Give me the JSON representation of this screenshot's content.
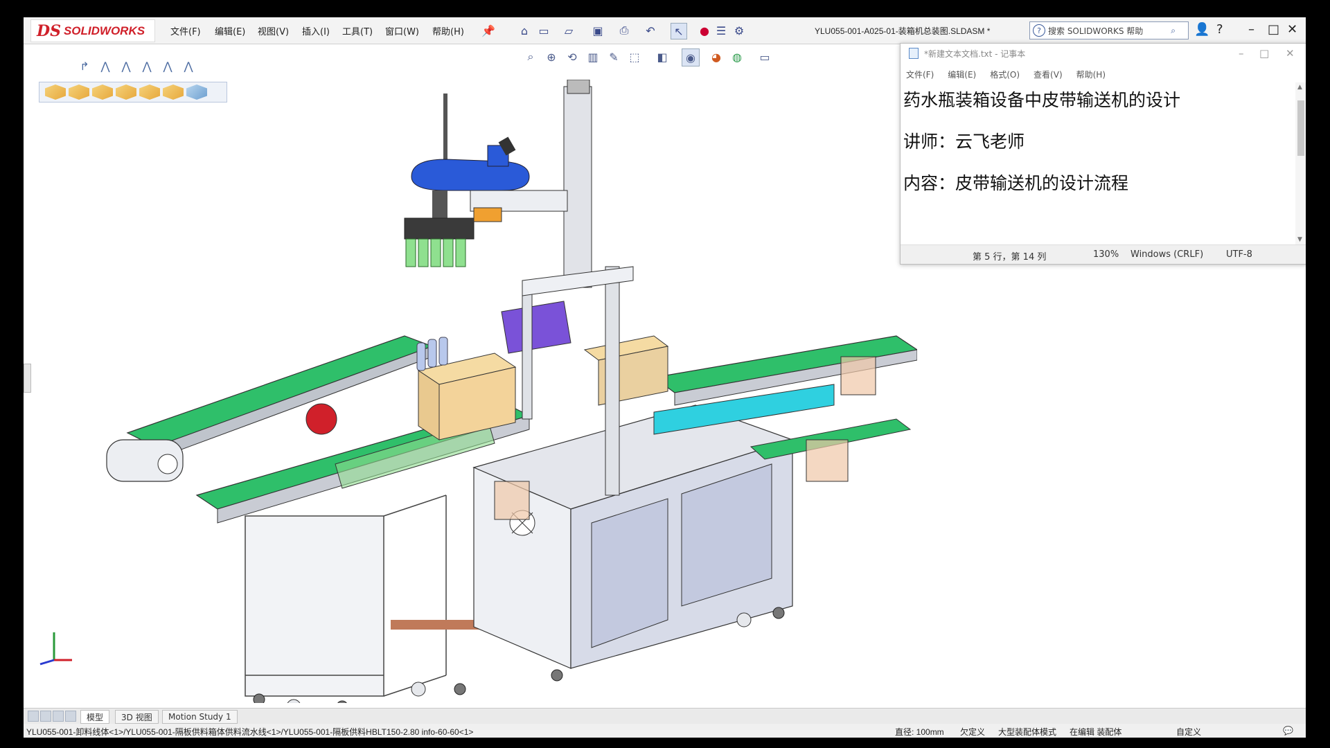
{
  "app": {
    "brand_ds": "DS",
    "brand_name": "SOLIDWORKS",
    "document_title": "YLU055-001-A025-01-装箱机总装图.SLDASM *",
    "search_placeholder": "搜索 SOLIDWORKS 帮助"
  },
  "menu": {
    "items": [
      "文件(F)",
      "编辑(E)",
      "视图(V)",
      "插入(I)",
      "工具(T)",
      "窗口(W)",
      "帮助(H)"
    ]
  },
  "notepad": {
    "title": "*新建文本文档.txt - 记事本",
    "menu": [
      "文件(F)",
      "编辑(E)",
      "格式(O)",
      "查看(V)",
      "帮助(H)"
    ],
    "lines": [
      "药水瓶装箱设备中皮带输送机的设计",
      "讲师：云飞老师",
      "内容：皮带输送机的设计流程"
    ],
    "status": {
      "position": "第 5 行，第 14 列",
      "zoom": "130%",
      "line_ending": "Windows (CRLF)",
      "encoding": "UTF-8"
    }
  },
  "tabs": {
    "items": [
      "模型",
      "3D 视图",
      "Motion Study 1"
    ],
    "active": "模型"
  },
  "statusbar": {
    "path": "YLU055-001-卸料线体<1>/YLU055-001-隔板供料箱体供料流水线<1>/YLU055-001-隔板供料HBLT150-2.80 info-60-60<1>",
    "diameter": "直径: 100mm",
    "under_defined": "欠定义",
    "mode": "大型装配体模式",
    "editing": "在编辑 装配体",
    "custom": "自定义"
  },
  "colors": {
    "conveyor_belt": "#2fbf6a",
    "conveyor_cyan": "#2fd0e0",
    "frame": "#d8dae0",
    "cabinet": "#cfd4e6",
    "box": "#e9c98f",
    "robot_blue": "#2a5ad8",
    "accent_red": "#d0202a"
  }
}
